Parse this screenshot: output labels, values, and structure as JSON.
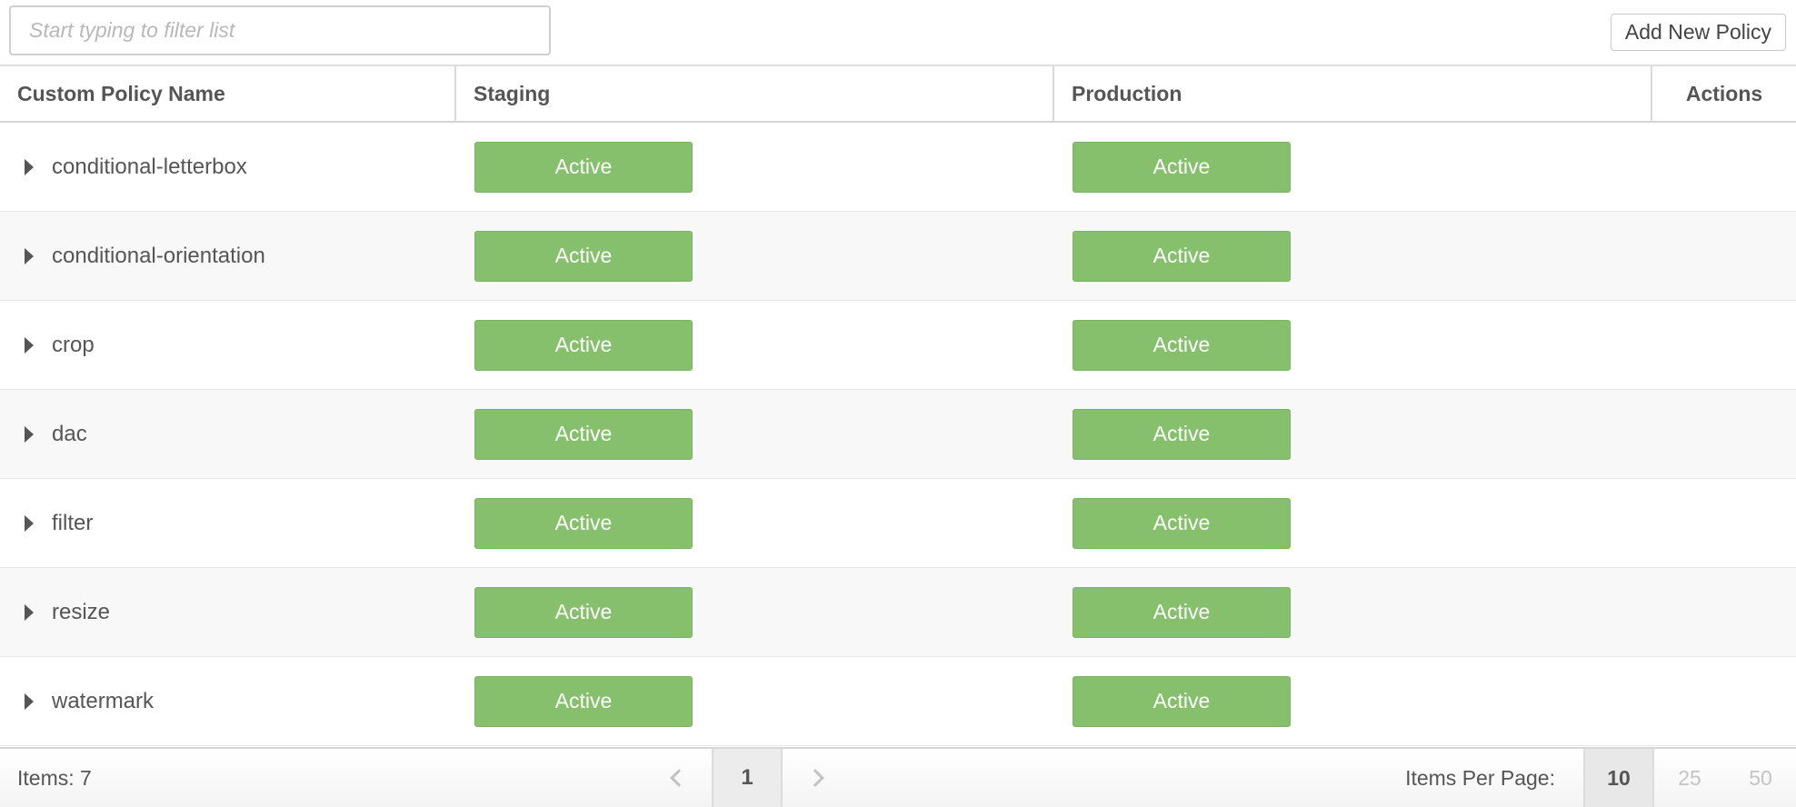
{
  "toolbar": {
    "filter_placeholder": "Start typing to filter list",
    "filter_value": "",
    "add_button_label": "Add New Policy"
  },
  "table": {
    "headers": {
      "name": "Custom Policy Name",
      "staging": "Staging",
      "production": "Production",
      "actions": "Actions"
    },
    "rows": [
      {
        "name": "conditional-letterbox",
        "staging": "Active",
        "production": "Active"
      },
      {
        "name": "conditional-orientation",
        "staging": "Active",
        "production": "Active"
      },
      {
        "name": "crop",
        "staging": "Active",
        "production": "Active"
      },
      {
        "name": "dac",
        "staging": "Active",
        "production": "Active"
      },
      {
        "name": "filter",
        "staging": "Active",
        "production": "Active"
      },
      {
        "name": "resize",
        "staging": "Active",
        "production": "Active"
      },
      {
        "name": "watermark",
        "staging": "Active",
        "production": "Active"
      }
    ]
  },
  "footer": {
    "items_label": "Items: 7",
    "current_page": "1",
    "per_page_label": "Items Per Page:",
    "per_page_options": [
      "10",
      "25",
      "50"
    ],
    "per_page_selected": "10"
  },
  "colors": {
    "active_badge": "#86c06c",
    "text": "#555555",
    "border": "#d4d4d4"
  }
}
